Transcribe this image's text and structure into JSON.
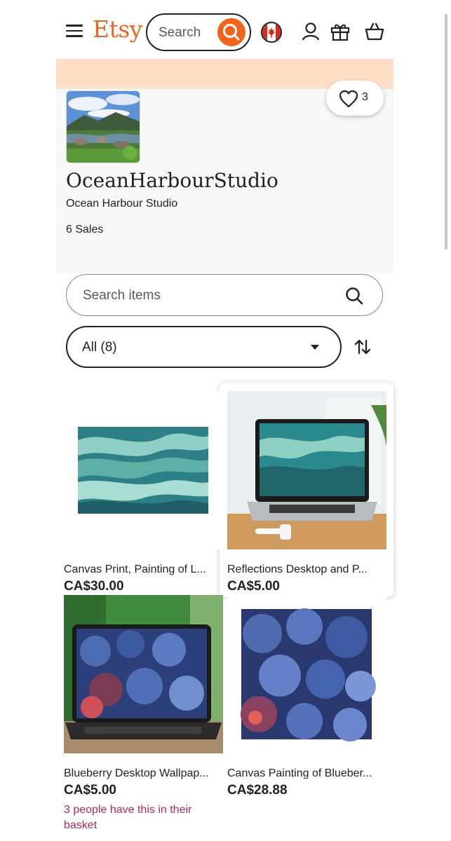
{
  "header": {
    "logo": "Etsy",
    "search_placeholder": "Search",
    "icons": [
      "menu-icon",
      "search-icon",
      "canada-flag-icon",
      "account-icon",
      "gift-icon",
      "basket-icon"
    ]
  },
  "shop": {
    "favorites_count": "3",
    "name": "OceanHarbourStudio",
    "subtitle": "Ocean Harbour Studio",
    "sales": "6 Sales"
  },
  "controls": {
    "items_search_placeholder": "Search items",
    "filter_value": "All (8)"
  },
  "listings": [
    {
      "title": "Canvas Print, Painting of L...",
      "price": "CA$30.00",
      "note": ""
    },
    {
      "title": "Reflections Desktop and P...",
      "price": "CA$5.00",
      "note": ""
    },
    {
      "title": "Blueberry Desktop Wallpap...",
      "price": "CA$5.00",
      "note": "3 people have this in their basket"
    },
    {
      "title": "Canvas Painting of Blueber...",
      "price": "CA$28.88",
      "note": ""
    }
  ],
  "colors": {
    "brand": "#f1641e",
    "banner": "#ffdfc7",
    "basket_note": "#b2285a"
  }
}
